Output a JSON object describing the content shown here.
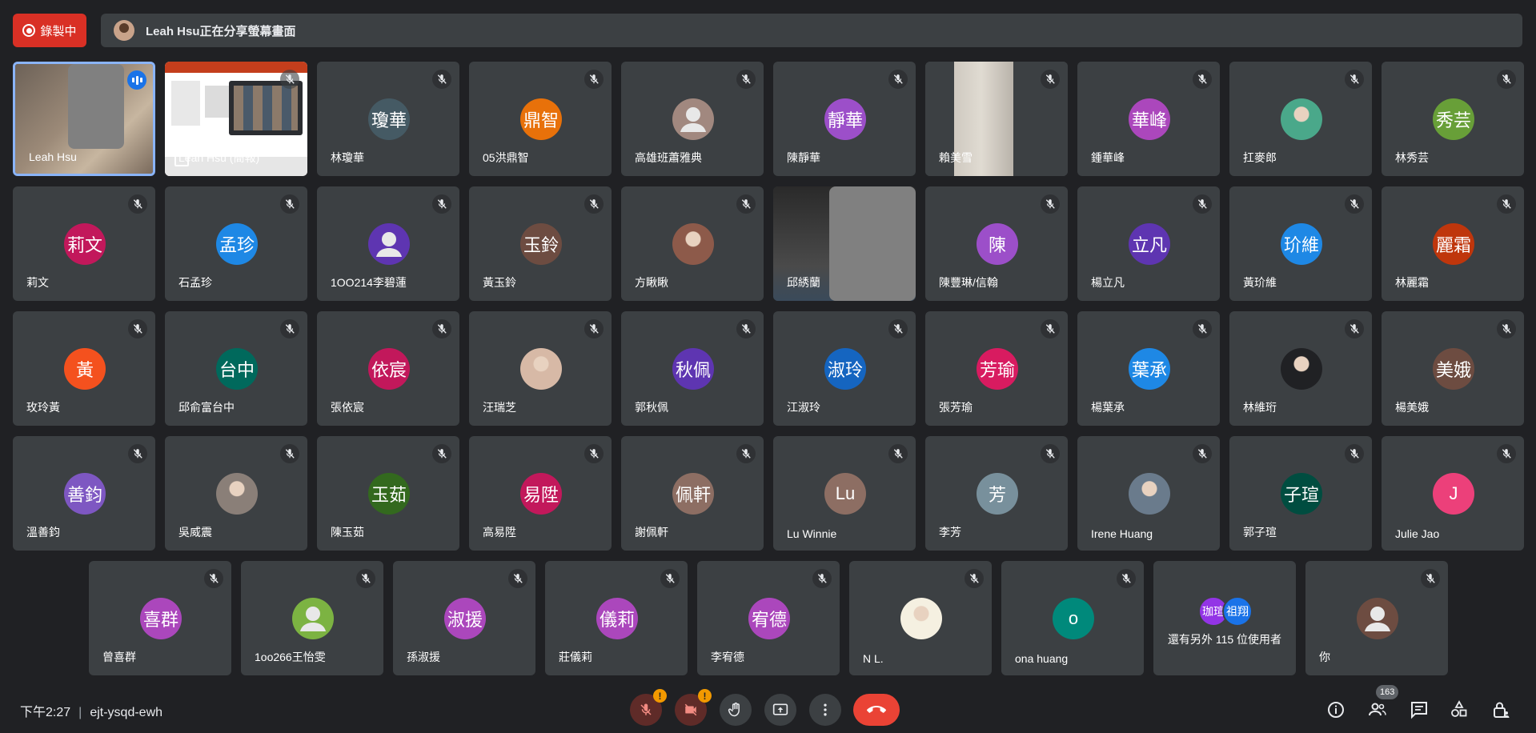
{
  "recording": {
    "label": "錄製中"
  },
  "banner": {
    "text": "Leah Hsu正在分享螢幕畫面"
  },
  "meeting": {
    "time": "下午2:27",
    "code": "ejt-ysqd-ewh"
  },
  "participants_count": "163",
  "more_tile": {
    "text": "還有另外 115 位使用者",
    "a1": "珈瑄",
    "a2": "祖翔",
    "c1": "#9334e6",
    "c2": "#1a73e8"
  },
  "tiles": [
    {
      "name": "Leah Hsu",
      "type": "video-speaking"
    },
    {
      "name": "Leah Hsu (簡報)",
      "type": "presentation"
    },
    {
      "name": "林瓊華",
      "initials": "瓊華",
      "color": "#455a64"
    },
    {
      "name": "05洪鼎智",
      "initials": "鼎智",
      "color": "#e8710a"
    },
    {
      "name": "高雄班蕭雅典",
      "type": "default-avatar",
      "color": "#a1887f"
    },
    {
      "name": "陳靜華",
      "initials": "靜華",
      "color": "#9c4fc9"
    },
    {
      "name": "賴美雪",
      "type": "video"
    },
    {
      "name": "鍾華峰",
      "initials": "華峰",
      "color": "#ab47bc"
    },
    {
      "name": "扛麥郎",
      "type": "photo",
      "color": "#4aa88a"
    },
    {
      "name": "林秀芸",
      "initials": "秀芸",
      "color": "#689f38"
    },
    {
      "name": "莉文",
      "initials": "莉文",
      "color": "#c2185b"
    },
    {
      "name": "石孟珍",
      "initials": "孟珍",
      "color": "#1e88e5"
    },
    {
      "name": "1OO214李碧蓮",
      "type": "default-avatar",
      "color": "#5e35b1"
    },
    {
      "name": "黃玉鈴",
      "initials": "玉鈴",
      "color": "#6d4c41"
    },
    {
      "name": "方瞅瞅",
      "type": "photo",
      "color": "#8d5a4a"
    },
    {
      "name": "邱綉蘭",
      "type": "video2"
    },
    {
      "name": "陳豐琳/信翰",
      "initials": "陳",
      "color": "#9c4fc9"
    },
    {
      "name": "楊立凡",
      "initials": "立凡",
      "color": "#5e35b1"
    },
    {
      "name": "黃玠維",
      "initials": "玠維",
      "color": "#1e88e5"
    },
    {
      "name": "林麗霜",
      "initials": "麗霜",
      "color": "#bf360c"
    },
    {
      "name": "玫玲黃",
      "initials": "黃",
      "color": "#f4511e"
    },
    {
      "name": "邱俞富台中",
      "initials": "台中",
      "color": "#00695c"
    },
    {
      "name": "張依宸",
      "initials": "依宸",
      "color": "#c2185b"
    },
    {
      "name": "汪瑞芝",
      "type": "photo",
      "color": "#d7b9a6"
    },
    {
      "name": "郭秋佩",
      "initials": "秋佩",
      "color": "#5e35b1"
    },
    {
      "name": "江淑玲",
      "initials": "淑玲",
      "color": "#1565c0"
    },
    {
      "name": "張芳瑜",
      "initials": "芳瑜",
      "color": "#d81b60"
    },
    {
      "name": "楊葉承",
      "initials": "葉承",
      "color": "#1e88e5"
    },
    {
      "name": "林維珩",
      "type": "photo",
      "color": "#202124"
    },
    {
      "name": "楊美娥",
      "initials": "美娥",
      "color": "#6d4c41"
    },
    {
      "name": "溫善鈞",
      "initials": "善鈞",
      "color": "#7e57c2"
    },
    {
      "name": "吳威震",
      "type": "photo",
      "color": "#8a7f78"
    },
    {
      "name": "陳玉茹",
      "initials": "玉茹",
      "color": "#33691e"
    },
    {
      "name": "高易陞",
      "initials": "易陞",
      "color": "#c2185b"
    },
    {
      "name": "謝佩軒",
      "initials": "佩軒",
      "color": "#8d6e63"
    },
    {
      "name": "Lu Winnie",
      "initials": "Lu",
      "color": "#8d6e63"
    },
    {
      "name": "李芳",
      "initials": "芳",
      "color": "#78909c"
    },
    {
      "name": "Irene Huang",
      "type": "photo",
      "color": "#6a7b8c"
    },
    {
      "name": "郭子瑄",
      "initials": "子瑄",
      "color": "#004d40"
    },
    {
      "name": "Julie Jao",
      "initials": "J",
      "color": "#ec407a"
    },
    {
      "name": "曾喜群",
      "initials": "喜群",
      "color": "#ab47bc"
    },
    {
      "name": "1oo266王怡雯",
      "type": "default-avatar",
      "color": "#7cb342"
    },
    {
      "name": "孫淑援",
      "initials": "淑援",
      "color": "#ab47bc"
    },
    {
      "name": "莊儀莉",
      "initials": "儀莉",
      "color": "#ab47bc"
    },
    {
      "name": "李宥德",
      "initials": "宥德",
      "color": "#ab47bc"
    },
    {
      "name": "N L.",
      "type": "photo",
      "color": "#f5f0e1"
    },
    {
      "name": "ona huang",
      "initials": "o",
      "color": "#00897b"
    },
    {
      "name": "more",
      "type": "more"
    },
    {
      "name": "你",
      "type": "default-avatar",
      "color": "#6d4c41"
    }
  ]
}
